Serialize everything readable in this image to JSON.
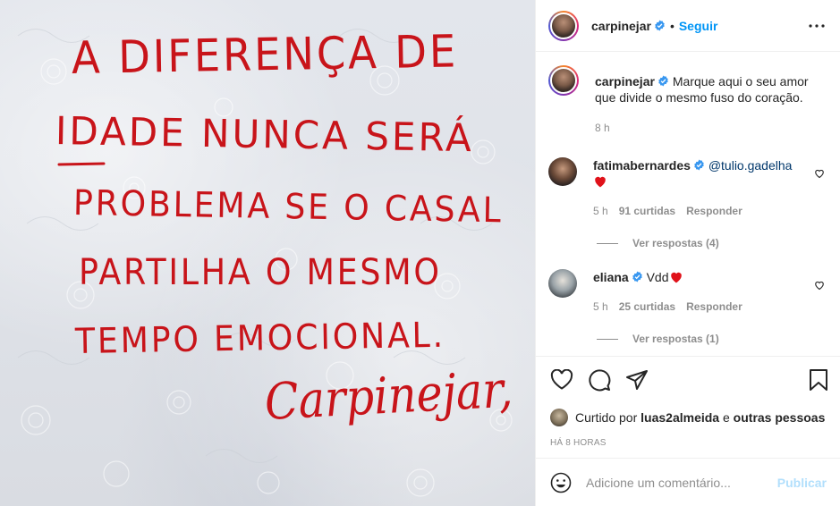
{
  "post": {
    "image_lines": [
      "A DIFERENÇA DE",
      "IDADE NUNCA SERÁ",
      "PROBLEMA SE O CASAL",
      "PARTILHA O MESMO",
      "TEMPO EMOCIONAL."
    ],
    "image_signature": "Carpinejar,"
  },
  "header": {
    "username": "carpinejar",
    "separator": "•",
    "follow_label": "Seguir"
  },
  "caption": {
    "username": "carpinejar",
    "text": "Marque aqui o seu amor que divide o mesmo fuso do coração.",
    "time": "8 h"
  },
  "comments": [
    {
      "username": "fatimabernardes",
      "mention": "@tulio.gadelha",
      "emoji": "❤️",
      "time": "5 h",
      "likes": "91 curtidas",
      "reply_label": "Responder",
      "view_replies": "Ver respostas (4)"
    },
    {
      "username": "eliana",
      "text": "Vdd",
      "emoji": "❤️",
      "time": "5 h",
      "likes": "25 curtidas",
      "reply_label": "Responder",
      "view_replies": "Ver respostas (1)"
    }
  ],
  "likes": {
    "prefix": "Curtido por",
    "user": "luas2almeida",
    "joiner": "e",
    "others": "outras pessoas"
  },
  "timestamp": "HÁ 8 HORAS",
  "comment_box": {
    "placeholder": "Adicione um comentário...",
    "publish_label": "Publicar"
  },
  "colors": {
    "accent": "#0095f6",
    "handwriting": "#c8141a",
    "like_red": "#ed4956",
    "publish_disabled": "#b2dffc"
  }
}
